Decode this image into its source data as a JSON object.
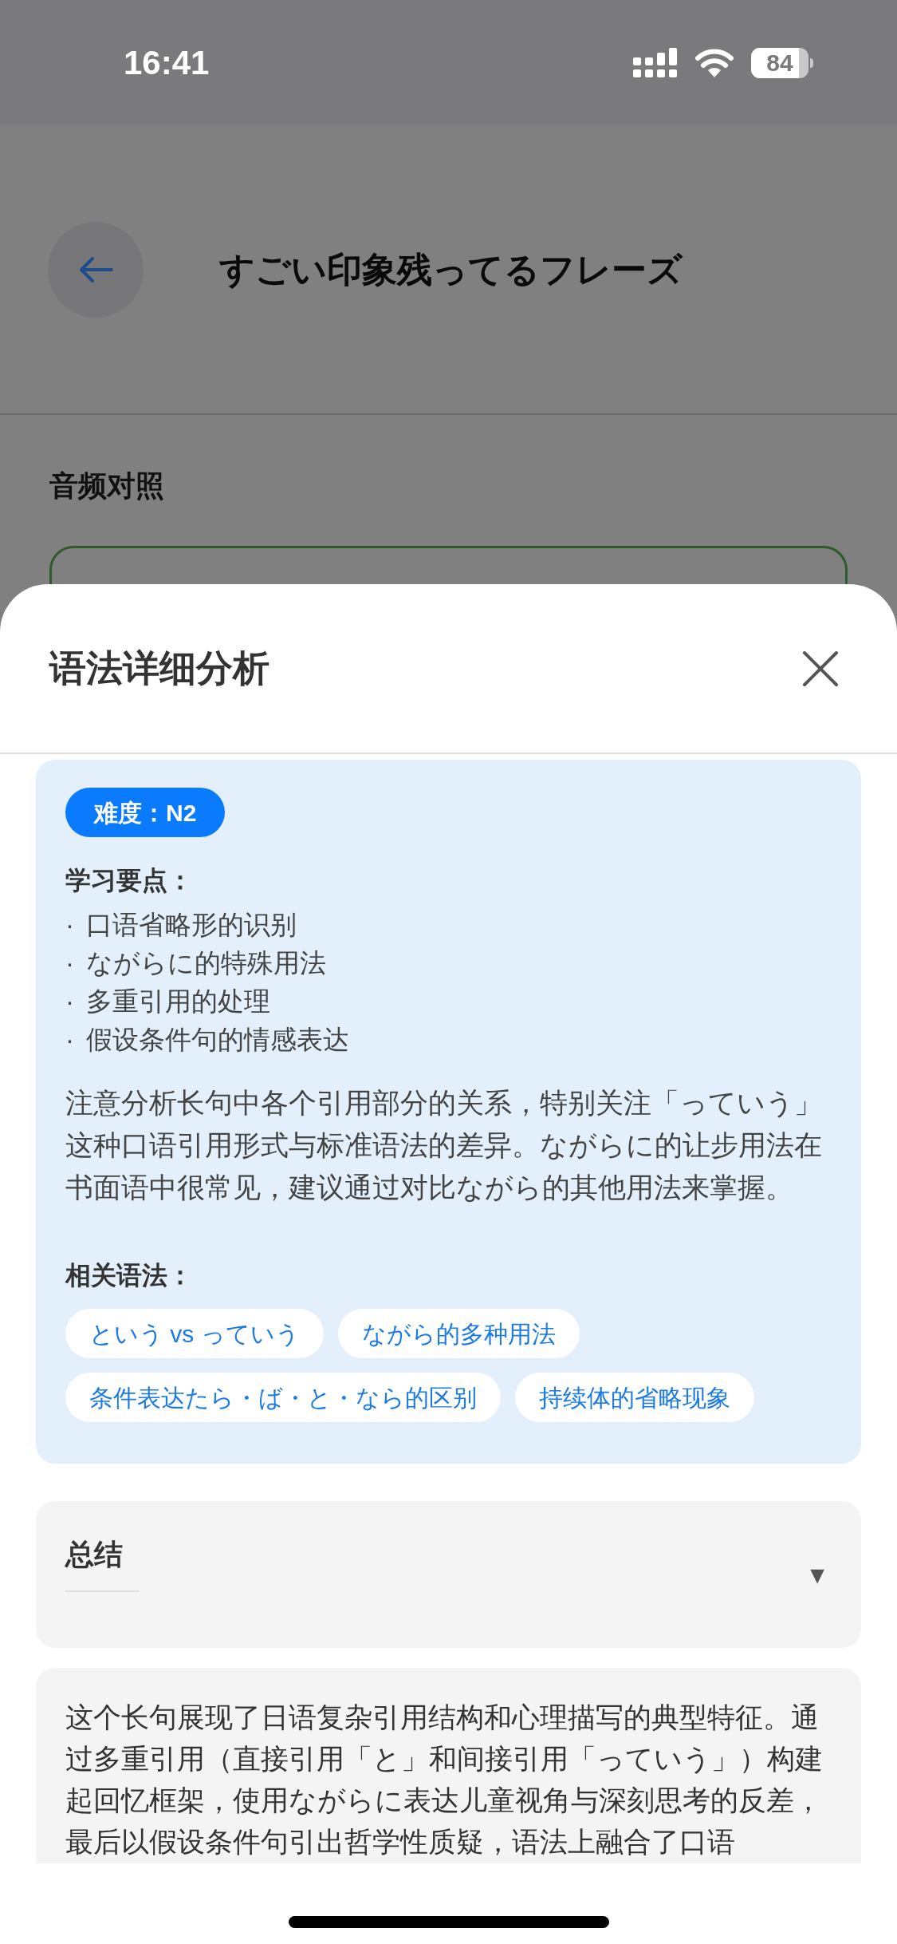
{
  "status_bar": {
    "time": "16:41",
    "battery": "84"
  },
  "header": {
    "title": "すごい印象残ってるフレーズ"
  },
  "section_title": "音频对照",
  "sheet": {
    "title": "语法详细分析",
    "analysis": {
      "difficulty": "难度：N2",
      "points_title": "学习要点：",
      "bullet": "·",
      "points": [
        "口语省略形的识别",
        "ながらに的特殊用法",
        "多重引用的处理",
        "假设条件句的情感表达"
      ],
      "note": "注意分析长句中各个引用部分的关系，特别关注「っていう」这种口语引用形式与标准语法的差异。ながらに的让步用法在书面语中很常见，建议通过对比ながら的其他用法来掌握。",
      "related_title": "相关语法：",
      "related": [
        "という vs っていう",
        "ながら的多种用法",
        "条件表达たら・ば・と・なら的区别",
        "持续体的省略现象"
      ]
    },
    "summary": {
      "title": "总结",
      "toggle": "▼"
    },
    "summary_text": "这个长句展现了日语复杂引用结构和心理描写的典型特征。通过多重引用（直接引用「と」和间接引用「っていう」）构建起回忆框架，使用ながらに表达儿童视角与深刻思考的反差，最后以假设条件句引出哲学性质疑，语法上融合了口语"
  }
}
